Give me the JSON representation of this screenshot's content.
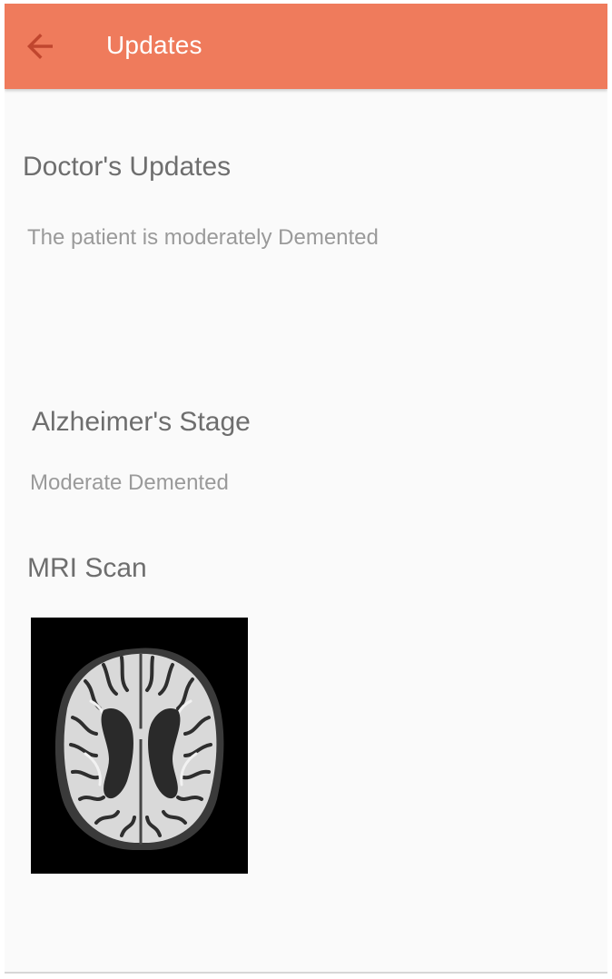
{
  "app_bar": {
    "title": "Updates",
    "back_icon": "arrow-left-icon",
    "background_color": "#ef7b5c"
  },
  "doctor_updates": {
    "heading": "Doctor's Updates",
    "message": "The patient is moderately Demented"
  },
  "alzheimers_stage": {
    "heading": "Alzheimer's Stage",
    "value": "Moderate Demented"
  },
  "mri_scan": {
    "heading": "MRI Scan",
    "image_content": "axial brain MRI"
  }
}
